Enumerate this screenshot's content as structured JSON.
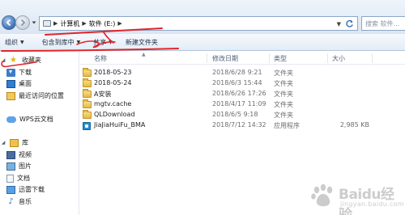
{
  "address_bar": {
    "path": [
      "计算机",
      "软件 (E:)"
    ],
    "search_placeholder": "搜索 软件..."
  },
  "toolbar": {
    "organize": "组织",
    "include_in_library": "包含到库中",
    "share": "共享",
    "new_folder": "新建文件夹"
  },
  "nav_pane": {
    "favorites": {
      "label": "收藏夹",
      "icon": "star-icon",
      "items": [
        {
          "label": "下载",
          "icon": "download-folder-icon"
        },
        {
          "label": "桌面",
          "icon": "desktop-icon"
        },
        {
          "label": "最近访问的位置",
          "icon": "recent-places-icon"
        }
      ]
    },
    "wps_cloud": {
      "label": "WPS云文档",
      "icon": "cloud-icon"
    },
    "libraries": {
      "label": "库",
      "icon": "library-icon",
      "items": [
        {
          "label": "视频",
          "icon": "video-library-icon"
        },
        {
          "label": "图片",
          "icon": "pictures-library-icon"
        },
        {
          "label": "文档",
          "icon": "documents-library-icon"
        },
        {
          "label": "迅雷下载",
          "icon": "xunlei-download-icon"
        },
        {
          "label": "音乐",
          "icon": "music-library-icon"
        }
      ]
    }
  },
  "file_list": {
    "columns": {
      "name": "名称",
      "modified": "修改日期",
      "type": "类型",
      "size": "大小"
    },
    "rows": [
      {
        "name": "2018-05-23",
        "modified": "2018/6/28 9:21",
        "type": "文件夹",
        "size": "",
        "icon": "folder-icon"
      },
      {
        "name": "2018-05-24",
        "modified": "2018/6/3 15:44",
        "type": "文件夹",
        "size": "",
        "icon": "folder-icon"
      },
      {
        "name": "A安装",
        "modified": "2018/6/26 17:26",
        "type": "文件夹",
        "size": "",
        "icon": "folder-icon"
      },
      {
        "name": "mgtv.cache",
        "modified": "2018/4/17 11:09",
        "type": "文件夹",
        "size": "",
        "icon": "folder-icon"
      },
      {
        "name": "QLDownload",
        "modified": "2018/6/5 9:18",
        "type": "文件夹",
        "size": "",
        "icon": "folder-icon"
      },
      {
        "name": "JiaJiaHuiFu_BMA",
        "modified": "2018/7/12 14:32",
        "type": "应用程序",
        "size": "2,985 KB",
        "icon": "application-icon"
      }
    ]
  },
  "annotation": {
    "color": "#e0262b"
  },
  "watermark": {
    "text": "Baidu经验",
    "sub": "jingyan.baidu.com"
  }
}
